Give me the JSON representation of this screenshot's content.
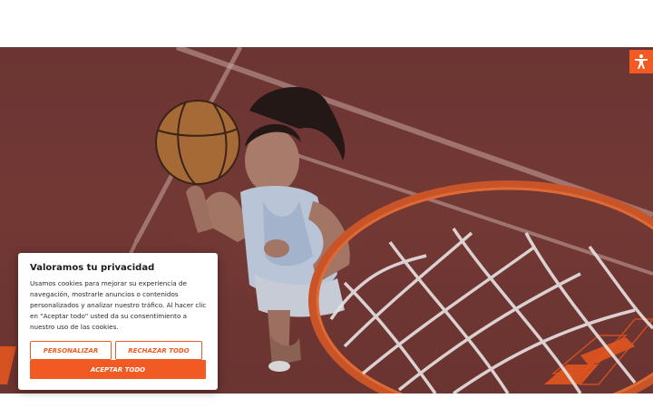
{
  "colors": {
    "accent": "#f15a22",
    "hero_overlay": "#6b3533"
  },
  "accessibility": {
    "icon": "accessibility-person-icon"
  },
  "hero": {
    "image_subject": "basketball-player-photo"
  },
  "cookie_banner": {
    "title": "Valoramos tu privacidad",
    "body": "Usamos cookies para mejorar su experiencia de navegación, mostrarle anuncios o contenidos personalizados y analizar nuestro tráfico. Al hacer clic en \"Aceptar todo\" usted da su consentimiento a nuestro uso de las cookies.",
    "customize_label": "PERSONALIZAR",
    "reject_label": "RECHAZAR TODO",
    "accept_label": "ACEPTAR TODO"
  }
}
